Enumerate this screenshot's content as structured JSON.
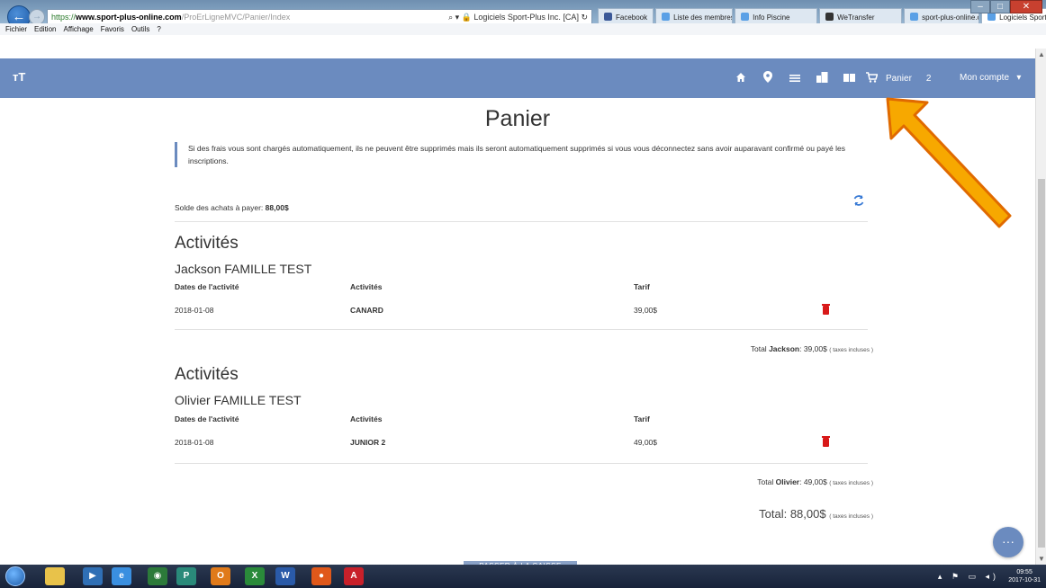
{
  "browser": {
    "url_https": "https://",
    "url_domain": "www.sport-plus-online.com",
    "url_path": "/ProErLigneMVC/Panier/Index",
    "url_search": "Logiciels Sport-Plus Inc. [CA]",
    "tabs": [
      "Facebook",
      "Liste des membres",
      "Info Piscine",
      "WeTransfer",
      "sport-plus-online.c...",
      "Logiciels Sport-..."
    ],
    "menu": [
      "Fichier",
      "Edition",
      "Affichage",
      "Favoris",
      "Outils",
      "?"
    ]
  },
  "header": {
    "logo": "ᴛT",
    "cart_label": "Panier",
    "cart_count": "2",
    "account_label": "Mon compte"
  },
  "page": {
    "title": "Panier",
    "notice": "Si des frais vous sont chargés automatiquement, ils ne peuvent être supprimés mais ils seront automatiquement supprimés si vous vous déconnectez sans avoir auparavant confirmé ou payé les inscriptions.",
    "balance_label": "Solde des achats à payer:",
    "balance_value": "88,00$",
    "col_dates": "Dates de l'activité",
    "col_activities": "Activités",
    "col_price": "Tarif",
    "sections": [
      {
        "title": "Activités",
        "person": "Jackson FAMILLE TEST",
        "row": {
          "date": "2018-01-08",
          "activity": "CANARD",
          "price": "39,00$"
        },
        "total_prefix": "Total",
        "total_name": "Jackson",
        "total_value": ": 39,00$",
        "total_note": "( taxes incluses )"
      },
      {
        "title": "Activités",
        "person": "Olivier FAMILLE TEST",
        "row": {
          "date": "2018-01-08",
          "activity": "JUNIOR 2",
          "price": "49,00$"
        },
        "total_prefix": "Total",
        "total_name": "Olivier",
        "total_value": ": 49,00$",
        "total_note": "( taxes incluses )"
      }
    ],
    "grand_total": "Total: 88,00$",
    "grand_total_note": "( taxes incluses )",
    "checkout_label": "PASSER À LA CAISSE",
    "fab_label": "···"
  },
  "taskbar": {
    "time": "09:55",
    "date": "2017-10-31"
  },
  "colors": {
    "header": "#6b8bbf",
    "arrow": "#f7a800",
    "trash": "#d81919"
  }
}
